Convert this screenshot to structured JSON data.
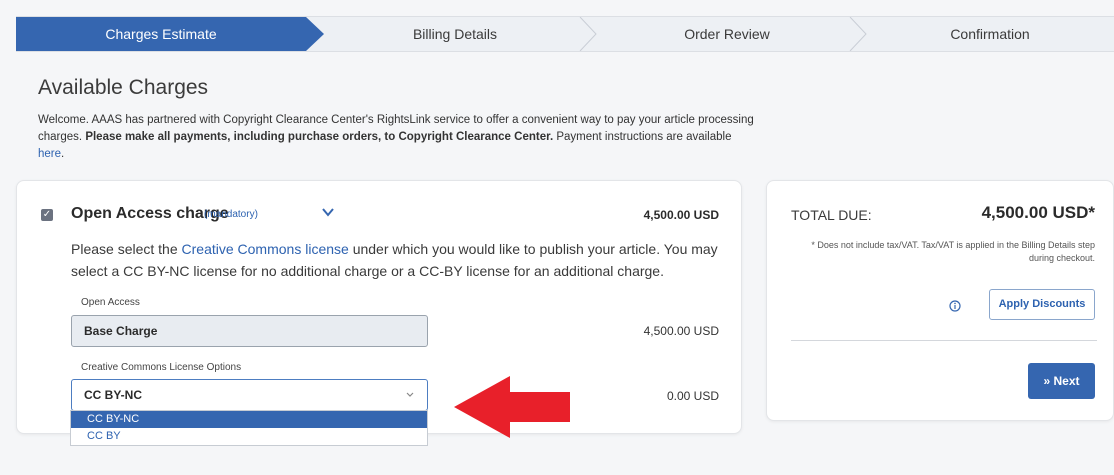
{
  "stepper": {
    "steps": [
      {
        "label": "Charges Estimate",
        "active": true
      },
      {
        "label": "Billing Details",
        "active": false
      },
      {
        "label": "Order Review",
        "active": false
      },
      {
        "label": "Confirmation",
        "active": false
      }
    ]
  },
  "page": {
    "title": "Available Charges",
    "intro_part1": "Welcome. AAAS has partnered with Copyright Clearance Center's RightsLink service to offer a convenient way to pay your article processing charges. ",
    "intro_bold": "Please make all payments, including purchase orders, to Copyright Clearance Center.",
    "intro_part2": " Payment instructions are available ",
    "intro_link": "here",
    "intro_end": "."
  },
  "charge": {
    "title": "Open Access charge",
    "mandatory": "(mandatory)",
    "amount": "4,500.00 USD",
    "desc_part1": "Please select the ",
    "desc_link": "Creative Commons license",
    "desc_part2": " under which you would like to publish your article. You may select a CC BY-NC license for no additional charge or a CC-BY license for an additional charge.",
    "open_access_label": "Open Access",
    "base_charge": "Base Charge",
    "base_amount": "4,500.00 USD",
    "license_label": "Creative Commons License Options",
    "license_value": "CC BY-NC",
    "license_amount": "0.00 USD",
    "license_options": [
      "CC BY-NC",
      "CC BY"
    ]
  },
  "total": {
    "label": "TOTAL DUE:",
    "amount": "4,500.00 USD*",
    "note": "* Does not include tax/VAT. Tax/VAT is applied in the Billing Details step during checkout.",
    "discount_button": "Apply Discounts",
    "next_button": "» Next"
  },
  "colors": {
    "accent": "#3566b0",
    "arrow": "#e8202a"
  }
}
